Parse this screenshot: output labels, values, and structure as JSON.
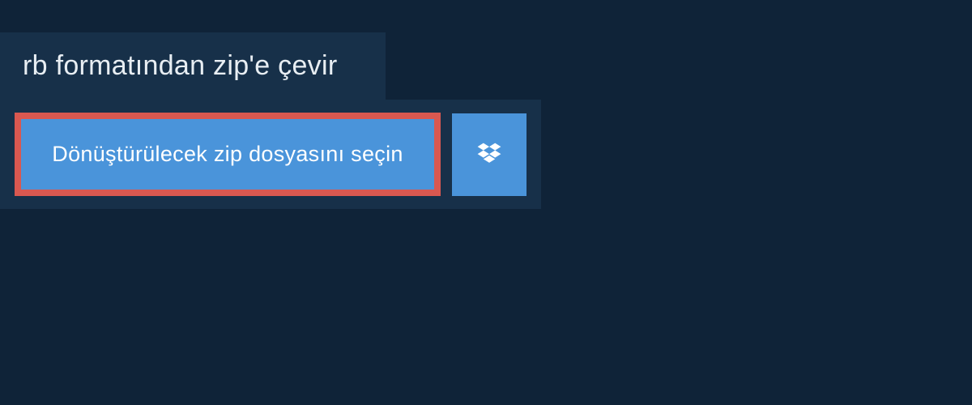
{
  "header": {
    "title": "rb formatından zip'e çevir"
  },
  "filePanel": {
    "selectButtonLabel": "Dönüştürülecek zip dosyasını seçin"
  },
  "colors": {
    "pageBackground": "#0f2338",
    "panelBackground": "#173049",
    "buttonBackground": "#4a94da",
    "buttonBorder": "#d95850",
    "textLight": "#e8eef3",
    "textWhite": "#ffffff"
  }
}
